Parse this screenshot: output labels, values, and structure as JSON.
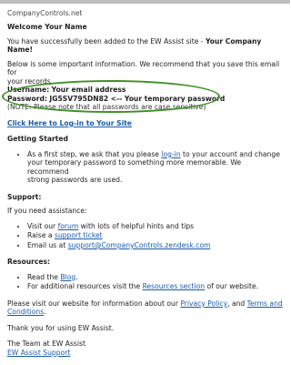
{
  "email": {
    "site_name": "CompanyControls.net",
    "greeting": "Welcome Your Name",
    "intro_pre": "You have successfully been added to the EW Assist site - ",
    "intro_company": "Your Company Name!",
    "info_line1": "Below is some important information. We recommend that you save this email for",
    "info_line2": "your records.",
    "username_label": "Username:",
    "username_value": "Your email address",
    "password_label": "Password:",
    "password_value": "JG5SV795DN82",
    "password_suffix": "<-- Your temporary password",
    "note": "(NOTE: Please note that all passwords are case sensitive)",
    "login_link": "Click Here to Log-in to Your Site",
    "getting_started": {
      "heading": "Getting Started",
      "line1_pre": "As a first step, we ask that you please ",
      "line1_link": "log-in",
      "line1_post": " to your account and change",
      "line2": "your temporary password to something more memorable. We recommend",
      "line3": "strong passwords are used."
    },
    "support": {
      "heading": "Support:",
      "intro": "If you need assistance:",
      "item1_pre": "Visit our ",
      "item1_link": "forum",
      "item1_post": " with lots of helpful hints and tips",
      "item2_pre": "Raise a ",
      "item2_link": "support ticket",
      "item3_pre": "Email us at ",
      "item3_link": "support@CompanyControls.zendesk.com"
    },
    "resources": {
      "heading": "Resources:",
      "item1_pre": "Read the ",
      "item1_link": "Blog",
      "item1_post": ".",
      "item2_pre": "For additional resources visit the ",
      "item2_link": "Resources section",
      "item2_post": " of our website."
    },
    "policy_pre": "Please visit our website for information about our ",
    "policy_link1": "Privacy Policy",
    "policy_mid": ", and ",
    "policy_link2": "Terms and",
    "policy_link2_line2": "Conditions",
    "policy_post": ".",
    "thanks": "Thank you for using EW Assist.",
    "signoff": "The Team at EW Assist",
    "signoff_link": "EW Assist Support"
  },
  "colors": {
    "link": "#1a5aa8",
    "highlight_oval": "#3f8f2c"
  }
}
